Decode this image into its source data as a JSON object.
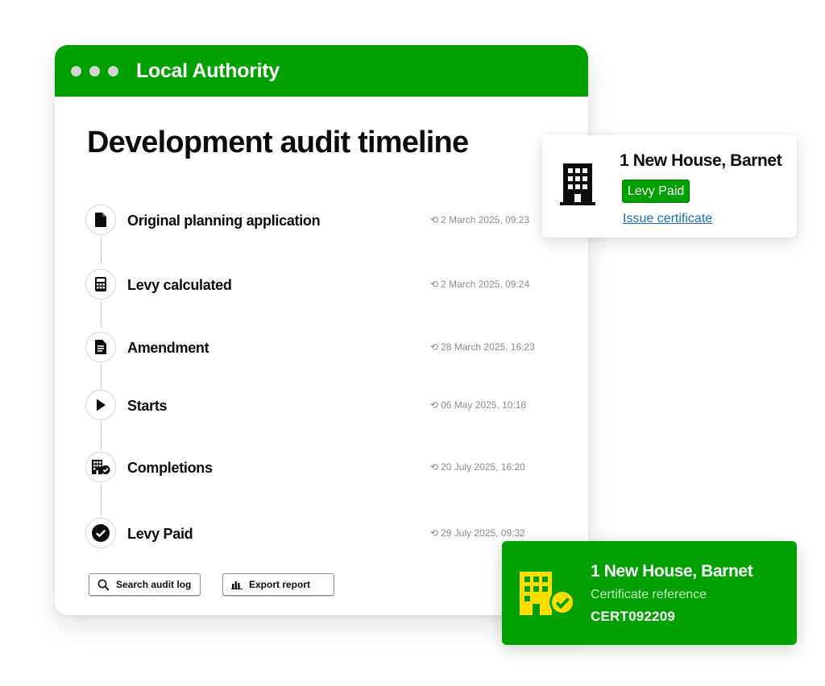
{
  "window": {
    "title": "Local Authority"
  },
  "page": {
    "title": "Development audit timeline"
  },
  "timeline": [
    {
      "icon": "document-icon",
      "label": "Original planning application",
      "time": "2 March 2025, 09:23"
    },
    {
      "icon": "calculator-icon",
      "label": "Levy calculated",
      "time": "2 March 2025, 09:24"
    },
    {
      "icon": "amendment-document-icon",
      "label": "Amendment",
      "time": "28 March 2025, 16:23"
    },
    {
      "icon": "play-icon",
      "label": "Starts",
      "time": "06 May 2025, 10:18"
    },
    {
      "icon": "building-check-icon",
      "label": "Completions",
      "time": "20 July 2025, 16:20"
    },
    {
      "icon": "check-circle-icon",
      "label": "Levy Paid",
      "time": "29 July 2025, 09:32"
    }
  ],
  "actions": {
    "search_label": "Search audit log",
    "export_label": "Export report"
  },
  "property_card": {
    "address": "1 New House, Barnet",
    "status": "Levy Paid",
    "link": "Issue certificate"
  },
  "certificate_card": {
    "address": "1 New House, Barnet",
    "ref_label": "Certificate reference",
    "ref": "CERT092209"
  },
  "colors": {
    "brand_green": "#00a000",
    "link_blue": "#1d70b8",
    "certificate_icon_yellow": "#ffdd00"
  }
}
